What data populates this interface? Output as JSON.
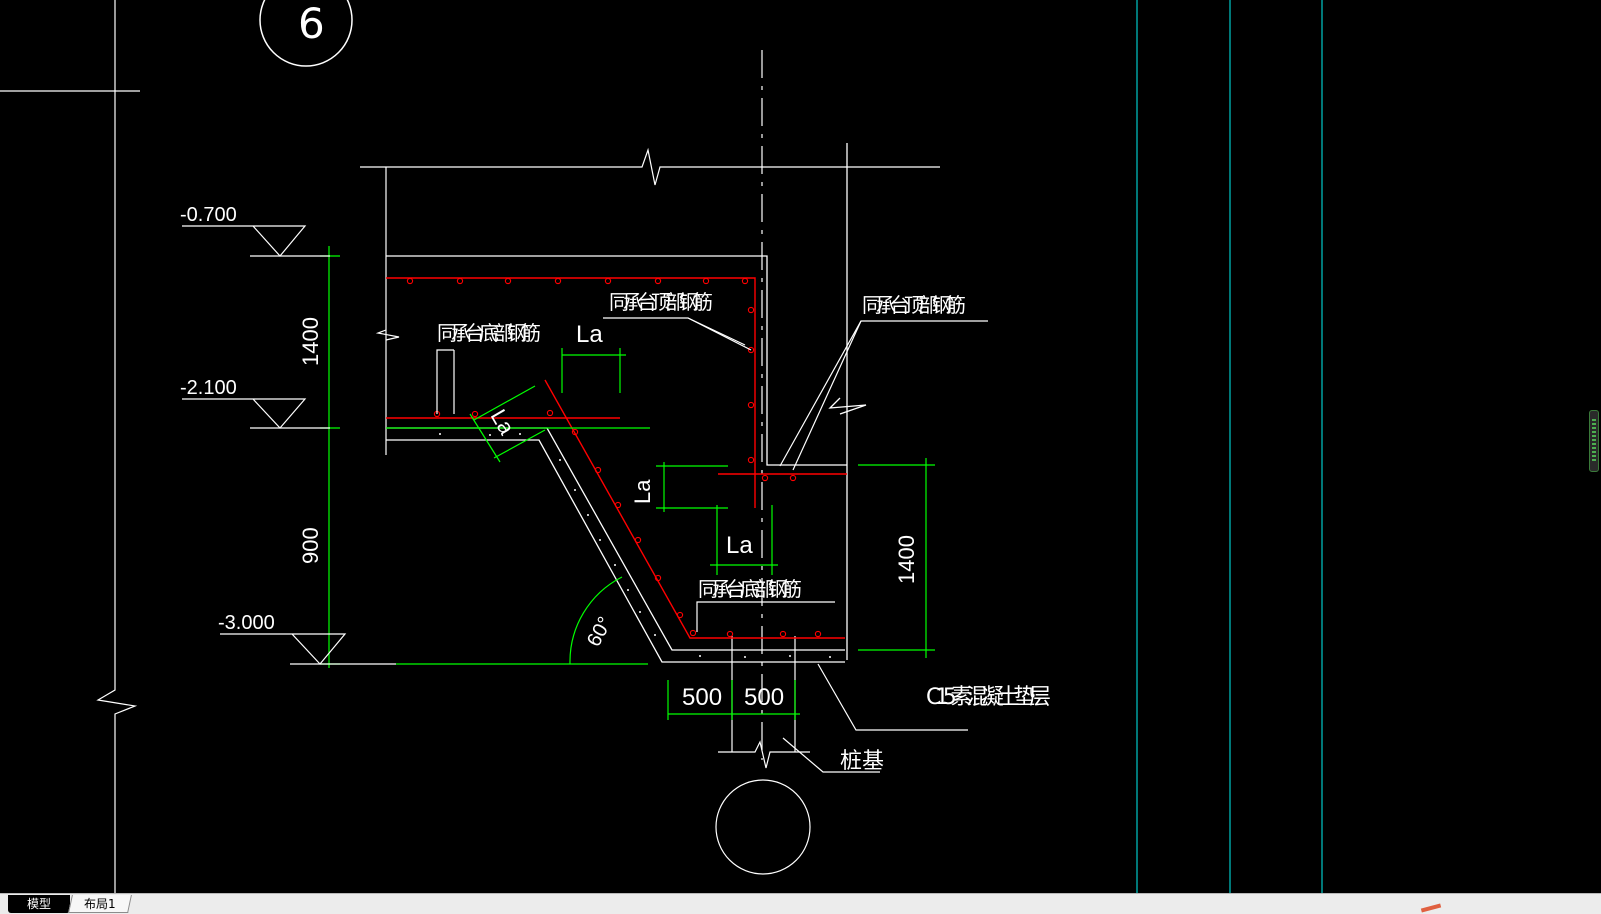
{
  "colors": {
    "background": "#000000",
    "line": "#ffffff",
    "dimension": "#00ff00",
    "rebar": "#ff0000",
    "grid": "#00c8c8"
  },
  "drawing": {
    "axis_label": "6",
    "elevations": {
      "top": "-0.700",
      "mid": "-2.100",
      "bottom": "-3.000"
    },
    "dimensions": {
      "left_upper": "1400",
      "left_lower": "900",
      "right": "1400",
      "bottom_left": "500",
      "bottom_right": "500",
      "angle": "60°"
    },
    "anchor_labels": {
      "la_top": "La",
      "la_slope": "La",
      "la_right": "La",
      "la_lower": "La"
    },
    "notes": {
      "bottom_rebar_upper": "同承台底部钢筋",
      "top_rebar_middle": "同承台顶部钢筋",
      "top_rebar_right": "同承台顶部钢筋",
      "bottom_rebar_lower": "同承台底部钢筋",
      "cushion": "C15素混凝土垫层",
      "pile": "桩基"
    }
  },
  "tabs": [
    {
      "label": "模型",
      "active": true
    },
    {
      "label": "布局1",
      "active": false
    }
  ]
}
